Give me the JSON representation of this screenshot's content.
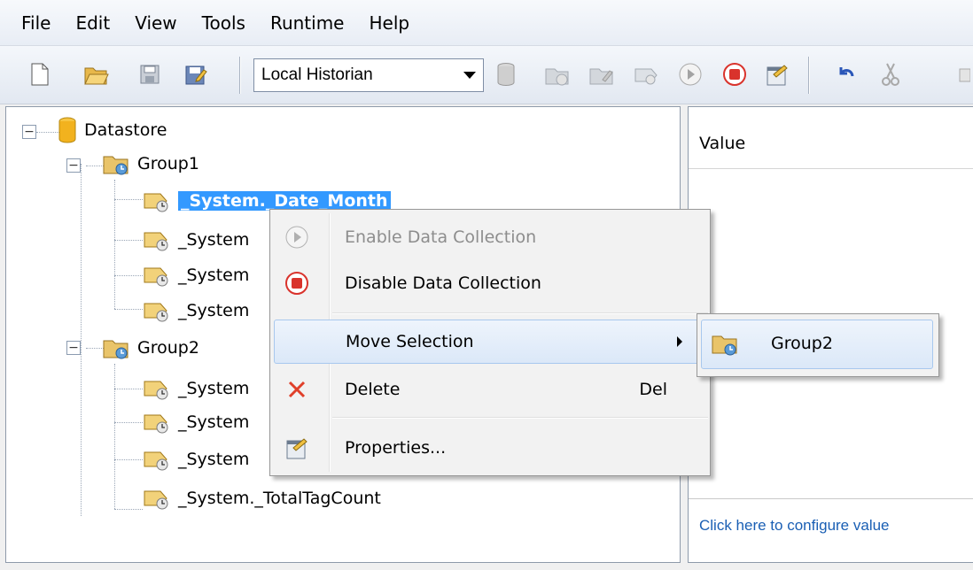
{
  "menubar": {
    "items": [
      "File",
      "Edit",
      "View",
      "Tools",
      "Runtime",
      "Help"
    ]
  },
  "toolbar": {
    "historian_selected": "Local Historian",
    "icons": [
      "new-document-icon",
      "open-folder-icon",
      "save-icon",
      "save-all-icon",
      "database-icon",
      "group-icon",
      "group-edit-icon",
      "tag-icon",
      "start-icon",
      "stop-icon",
      "properties-icon",
      "undo-icon",
      "cut-icon"
    ]
  },
  "tree": {
    "root": "Datastore",
    "group1": "Group1",
    "group1_items": [
      "_System._Date_Month",
      "_System",
      "_System",
      "_System"
    ],
    "group2": "Group2",
    "group2_items": [
      "_System",
      "_System",
      "_System",
      "_System._TotalTagCount"
    ]
  },
  "value_panel": {
    "header": "Value",
    "link": "Click here to configure value"
  },
  "context_menu": {
    "enable": "Enable Data Collection",
    "disable": "Disable Data Collection",
    "move": "Move Selection",
    "delete": "Delete",
    "delete_shortcut": "Del",
    "properties": "Properties..."
  },
  "submenu": {
    "group2": "Group2"
  },
  "colors": {
    "selection": "#3399ff",
    "link": "#1a5fb4",
    "stop_red": "#d9332c"
  }
}
